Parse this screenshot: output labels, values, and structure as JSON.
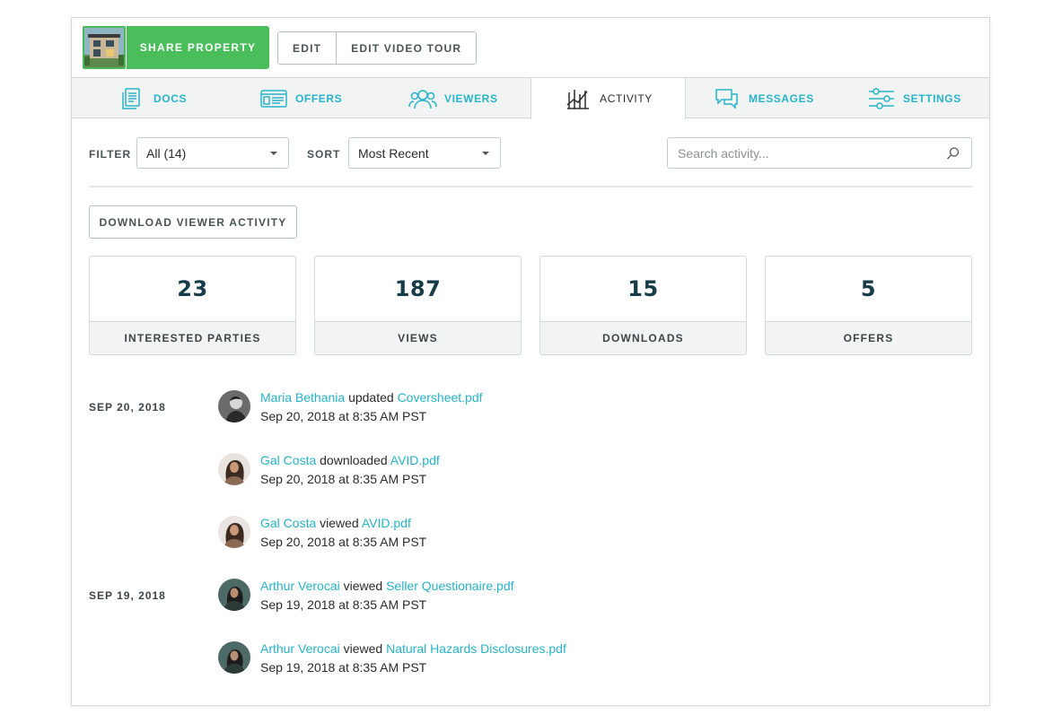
{
  "header": {
    "share_label": "SHARE PROPERTY",
    "edit_label": "EDIT",
    "edit_tour_label": "EDIT VIDEO TOUR"
  },
  "tabs": [
    {
      "label": "DOCS",
      "icon": "docs-icon"
    },
    {
      "label": "OFFERS",
      "icon": "offers-icon"
    },
    {
      "label": "VIEWERS",
      "icon": "viewers-icon"
    },
    {
      "label": "ACTIVITY",
      "icon": "activity-icon",
      "active": true
    },
    {
      "label": "MESSAGES",
      "icon": "messages-icon"
    },
    {
      "label": "SETTINGS",
      "icon": "settings-icon"
    }
  ],
  "filters": {
    "filter_label": "FILTER",
    "filter_value": "All (14)",
    "sort_label": "SORT",
    "sort_value": "Most Recent",
    "search_placeholder": "Search activity..."
  },
  "download_label": "DOWNLOAD VIEWER ACTIVITY",
  "stats": [
    {
      "value": "23",
      "label": "INTERESTED PARTIES"
    },
    {
      "value": "187",
      "label": "VIEWS"
    },
    {
      "value": "15",
      "label": "DOWNLOADS"
    },
    {
      "value": "5",
      "label": "OFFERS"
    }
  ],
  "dates": [
    "SEP 20, 2018",
    "SEP 19, 2018"
  ],
  "activity": [
    {
      "user": "Maria Bethania",
      "action": "updated",
      "file": "Coversheet.pdf",
      "time": "Sep 20, 2018 at 8:35 AM PST"
    },
    {
      "user": "Gal Costa",
      "action": "downloaded",
      "file": "AVID.pdf",
      "time": "Sep 20, 2018 at 8:35 AM PST"
    },
    {
      "user": "Gal Costa",
      "action": "viewed",
      "file": "AVID.pdf",
      "time": "Sep 20, 2018 at 8:35 AM PST"
    },
    {
      "user": "Arthur Verocai",
      "action": "viewed",
      "file": "Seller Questionaire.pdf",
      "time": "Sep 19, 2018 at 8:35 AM PST"
    },
    {
      "user": "Arthur Verocai",
      "action": "viewed",
      "file": "Natural Hazards Disclosures.pdf",
      "time": "Sep 19, 2018 at 8:35 AM PST"
    }
  ],
  "colors": {
    "accent": "#27b3c9",
    "share_green": "#4bbe5c",
    "stat_number": "#163c4a"
  }
}
